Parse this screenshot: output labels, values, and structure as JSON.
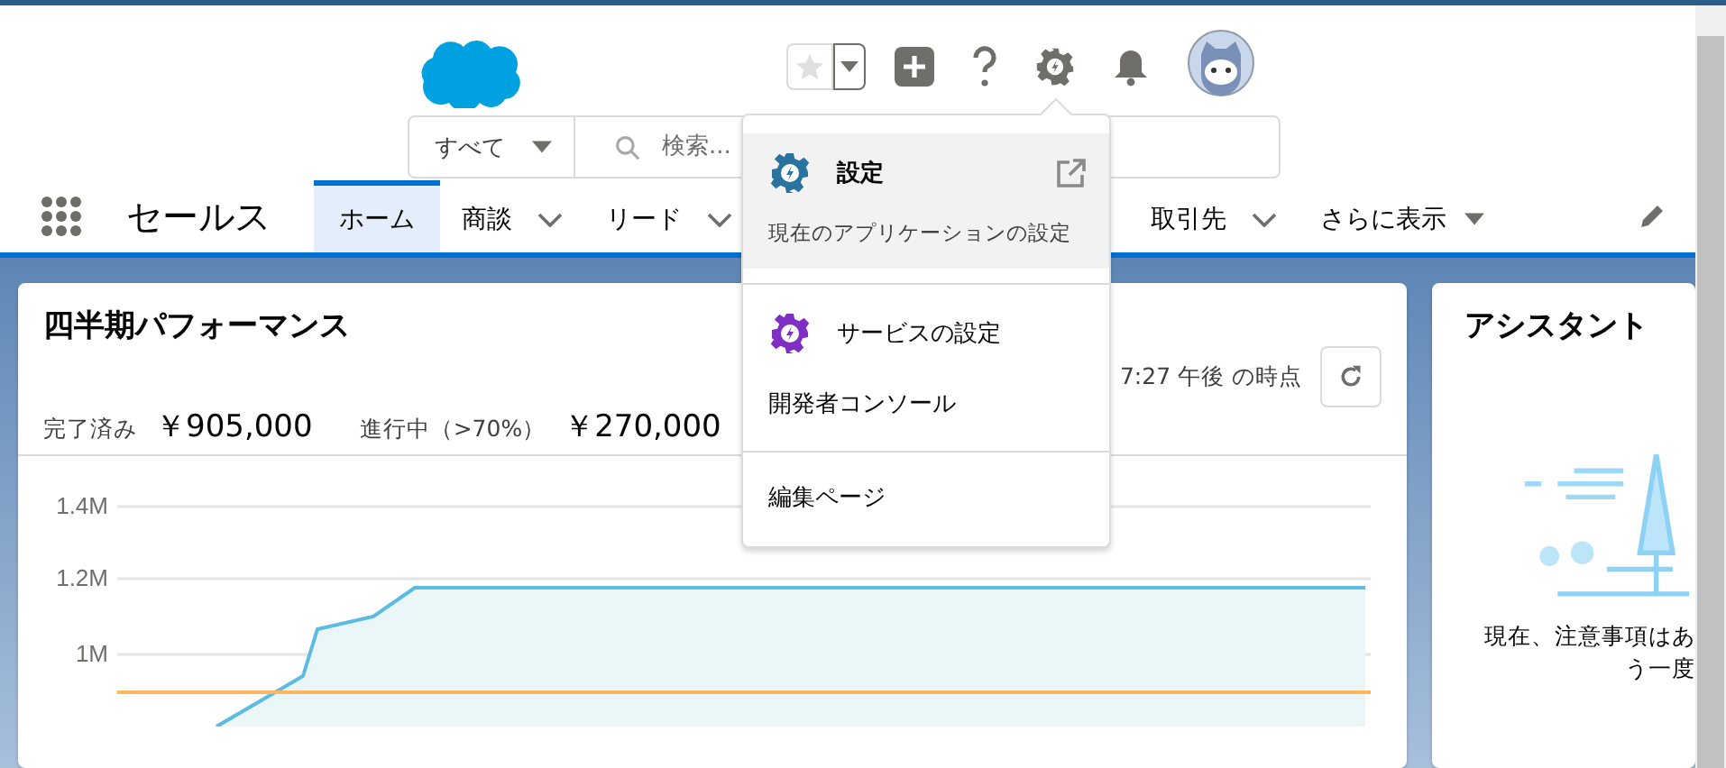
{
  "search": {
    "scope": "すべて",
    "placeholder": "検索..."
  },
  "app_name": "セールス",
  "nav_tabs": [
    {
      "label": "ホーム",
      "selected": true,
      "kind": "plain"
    },
    {
      "label": "商談",
      "selected": false,
      "kind": "menu"
    },
    {
      "label": "リード",
      "selected": false,
      "kind": "menu"
    },
    {
      "label": "取引先",
      "selected": false,
      "kind": "menu"
    },
    {
      "label": "さらに表示",
      "selected": false,
      "kind": "more"
    }
  ],
  "setup_menu": {
    "sections": [
      [
        {
          "kind": "header",
          "label": "設定",
          "description": "現在のアプリケーションの設定",
          "highlighted": true
        }
      ],
      [
        {
          "kind": "service",
          "label": "サービスの設定",
          "highlighted": false
        },
        {
          "kind": "plain",
          "label": "開発者コンソール",
          "highlighted": false
        }
      ],
      [
        {
          "kind": "plain",
          "label": "編集ページ",
          "highlighted": false
        }
      ]
    ]
  },
  "performance_card": {
    "title": "四半期パフォーマンス",
    "as_of": "7:27 午後 の時点",
    "closed_label": "完了済み",
    "closed_value": "￥905,000",
    "open_label": "進行中（>70%）",
    "open_value": "￥270,000",
    "y_ticks": [
      "1.4M",
      "1.2M",
      "1M"
    ]
  },
  "assistant_card": {
    "title": "アシスタント",
    "message_lines": [
      "現在、注意事項はあ",
      "う一度"
    ]
  }
}
